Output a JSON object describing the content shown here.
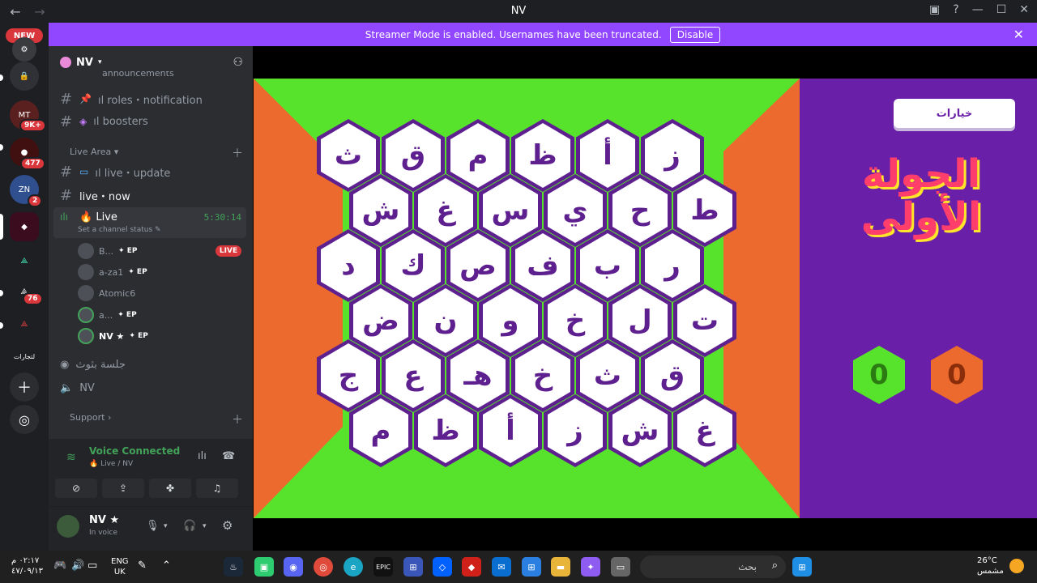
{
  "window": {
    "title": "NV"
  },
  "banner": {
    "text": "Streamer Mode is enabled. Usernames have been truncated.",
    "button": "Disable"
  },
  "servers": {
    "new_label": "NEW",
    "badges": [
      "9K+",
      "477",
      "2",
      "76"
    ],
    "special_label": "لتجارات"
  },
  "guild": {
    "name": "NV"
  },
  "channels": {
    "partial_top": "announcements",
    "items": [
      {
        "label": "ıl roles・notification",
        "icon": "pin"
      },
      {
        "label": "ıl boosters",
        "icon": "booster"
      }
    ],
    "category_live": "Live Area",
    "live_update": "ıl live・update",
    "live_now": "live・now",
    "voice_live": {
      "name": "Live",
      "time": "5:30:14",
      "status": "Set a channel status"
    },
    "voice_users": [
      {
        "name": "B...",
        "tag": "EP",
        "live": true
      },
      {
        "name": "a-za1",
        "tag": "EP",
        "live": false
      },
      {
        "name": "Atomic6",
        "tag": "",
        "live": false
      },
      {
        "name": "a...",
        "tag": "EP",
        "live": false
      },
      {
        "name": "NV ★",
        "tag": "EP",
        "live": false
      }
    ],
    "live_badge": "LIVE",
    "stage_channel": "جلسة بثوث",
    "voice_nv": "NV",
    "category_support": "Support"
  },
  "voice_panel": {
    "title": "Voice Connected",
    "subtitle": "Live / NV"
  },
  "user_panel": {
    "name": "NV ★",
    "status": "In voice"
  },
  "game": {
    "options_label": "خيارات",
    "round_title_1": "الجولة",
    "round_title_2": "الأولى",
    "score_green": "0",
    "score_orange": "0",
    "rows": [
      [
        "ز",
        "أ",
        "ظ",
        "م",
        "ق",
        "ث"
      ],
      [
        "ط",
        "ح",
        "ي",
        "س",
        "غ",
        "ش"
      ],
      [
        "ر",
        "ب",
        "ف",
        "ص",
        "ك",
        "د"
      ],
      [
        "ت",
        "ل",
        "خ",
        "و",
        "ن",
        "ض"
      ],
      [
        "ق",
        "ث",
        "خ",
        "هـ",
        "ع",
        "ج"
      ],
      [
        "غ",
        "ش",
        "ز",
        "أ",
        "ظ",
        "م"
      ]
    ]
  },
  "taskbar": {
    "time": "٠٢:١٧ م",
    "date": "٤٧/٠٩/١٣",
    "lang_1": "ENG",
    "lang_2": "UK",
    "search": "بحث",
    "temp": "26°C",
    "weather": "مشمس"
  },
  "colors": {
    "banner": "#9146ff",
    "board_green": "#57e32c",
    "board_orange": "#ec6a2e",
    "side_purple": "#6a1fa8"
  }
}
